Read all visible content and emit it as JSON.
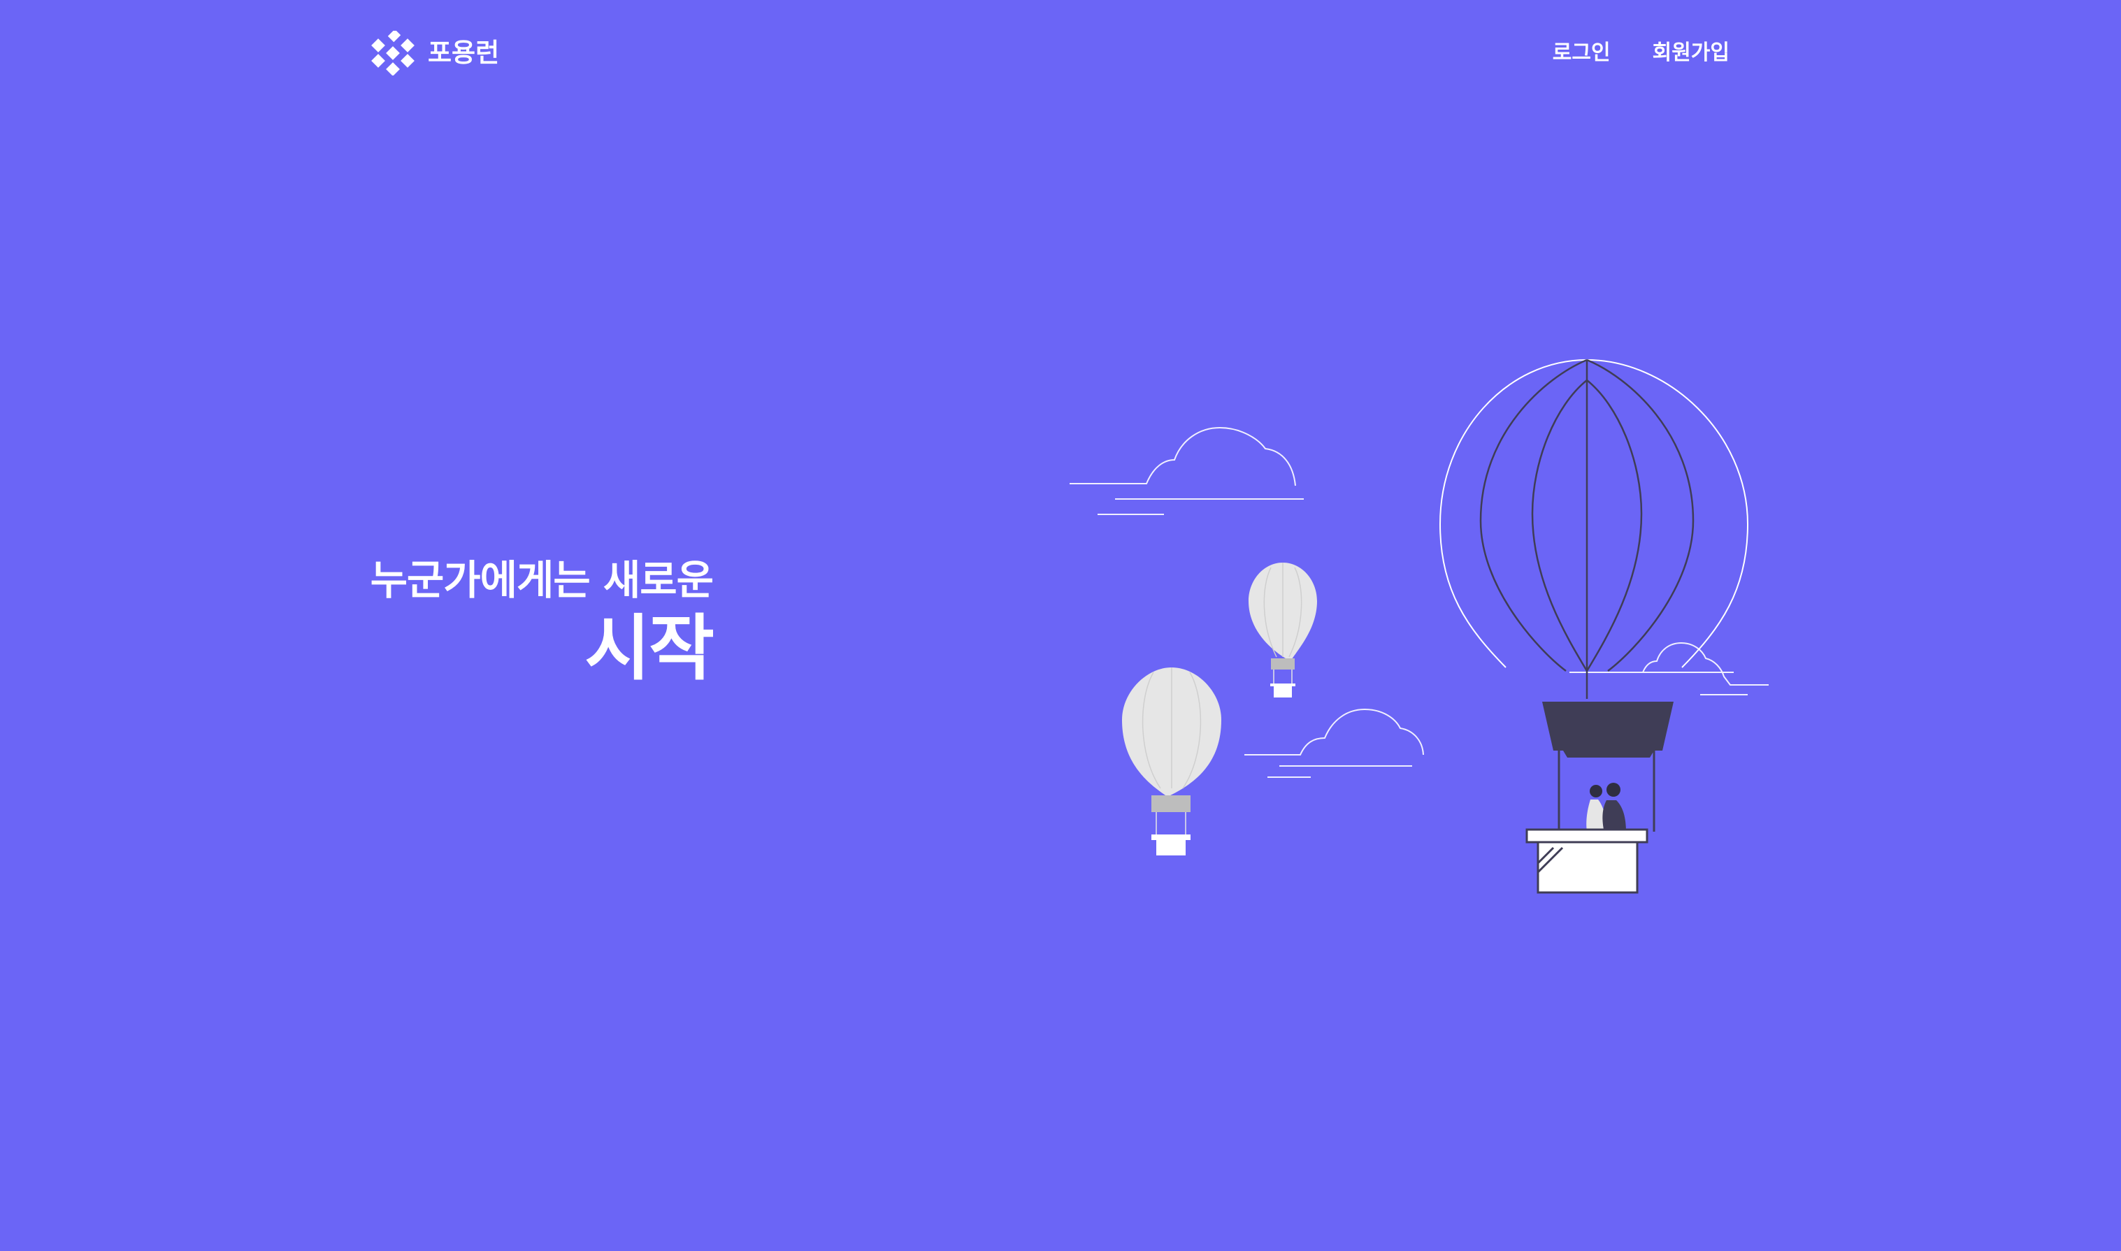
{
  "brand": {
    "name": "포용런",
    "logo_icon": "brand-cross-logo"
  },
  "nav": {
    "login": "로그인",
    "signup": "회원가입"
  },
  "hero": {
    "line1": "누군가에게는 새로운",
    "line2": "시작"
  },
  "illustration": {
    "icon": "hot-air-balloons-illustration",
    "colors": {
      "background": "#6b65f6",
      "balloon_dark": "#3f3d56",
      "balloon_light": "#e6e6e6",
      "outline": "#ffffff"
    }
  }
}
